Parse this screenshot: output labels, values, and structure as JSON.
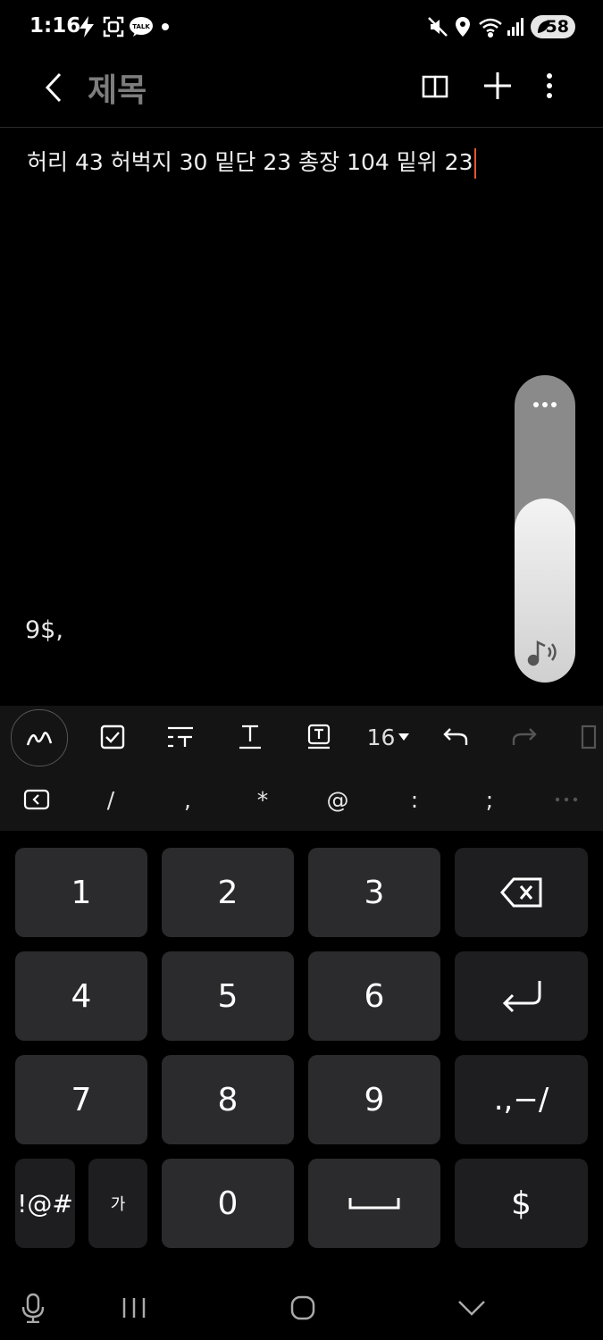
{
  "status_bar": {
    "time": "1:16",
    "battery": "58"
  },
  "header": {
    "title": "제목"
  },
  "note": {
    "text": "허리 43 허벅지 30 밑단 23 총장 104 밑위 23",
    "handwriting": "9$,"
  },
  "volume": {
    "level": 0.6
  },
  "toolbar": {
    "font_size": "16"
  },
  "symbol_row": [
    "/",
    ",",
    "*",
    "@",
    ":",
    ";"
  ],
  "keyboard": {
    "keys": [
      "1",
      "2",
      "3",
      "4",
      "5",
      "6",
      "7",
      "8",
      "9",
      "0"
    ],
    "punct_key": ".,−/",
    "symbols_key": "!@#",
    "lang_key": "가",
    "dollar_key": "$"
  },
  "colors": {
    "cursor": "#e8542f",
    "title": "#7d7d7d",
    "key_bg": "#2b2b2d"
  }
}
